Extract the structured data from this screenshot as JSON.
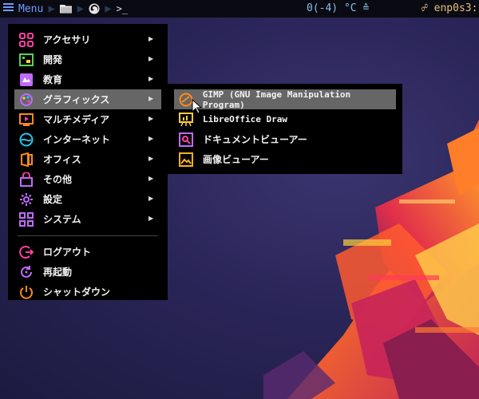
{
  "panel": {
    "menu_label": "Menu",
    "temperature": "0(-4) °C ≙",
    "network": "enp0s3:"
  },
  "main_menu": {
    "items": [
      {
        "label": "アクセサリ",
        "icon": "accessories-icon",
        "has_submenu": true
      },
      {
        "label": "開発",
        "icon": "development-icon",
        "has_submenu": true
      },
      {
        "label": "教育",
        "icon": "education-icon",
        "has_submenu": true
      },
      {
        "label": "グラフィックス",
        "icon": "graphics-icon",
        "has_submenu": true,
        "active": true
      },
      {
        "label": "マルチメディア",
        "icon": "multimedia-icon",
        "has_submenu": true
      },
      {
        "label": "インターネット",
        "icon": "internet-icon",
        "has_submenu": true
      },
      {
        "label": "オフィス",
        "icon": "office-icon",
        "has_submenu": true
      },
      {
        "label": "その他",
        "icon": "other-icon",
        "has_submenu": true
      },
      {
        "label": "設定",
        "icon": "settings-icon",
        "has_submenu": true
      },
      {
        "label": "システム",
        "icon": "system-icon",
        "has_submenu": true
      }
    ],
    "session": [
      {
        "label": "ログアウト",
        "icon": "logout-icon"
      },
      {
        "label": "再起動",
        "icon": "reboot-icon"
      },
      {
        "label": "シャットダウン",
        "icon": "shutdown-icon"
      }
    ]
  },
  "sub_menu": {
    "items": [
      {
        "label": "GIMP (GNU Image Manipulation Program)",
        "icon": "gimp-icon",
        "active": true
      },
      {
        "label": "LibreOffice Draw",
        "icon": "libreoffice-draw-icon"
      },
      {
        "label": "ドキュメントビューアー",
        "icon": "document-viewer-icon"
      },
      {
        "label": "画像ビューアー",
        "icon": "image-viewer-icon"
      }
    ]
  },
  "colors": {
    "panel_bg": "#0a0a12",
    "menu_bg": "#000000",
    "highlight": "#666666",
    "icon_pink": "#ff3fa4",
    "icon_orange": "#ff8a1c",
    "icon_green": "#55d35a",
    "icon_cyan": "#22c6e8",
    "icon_purple": "#c06bff"
  }
}
